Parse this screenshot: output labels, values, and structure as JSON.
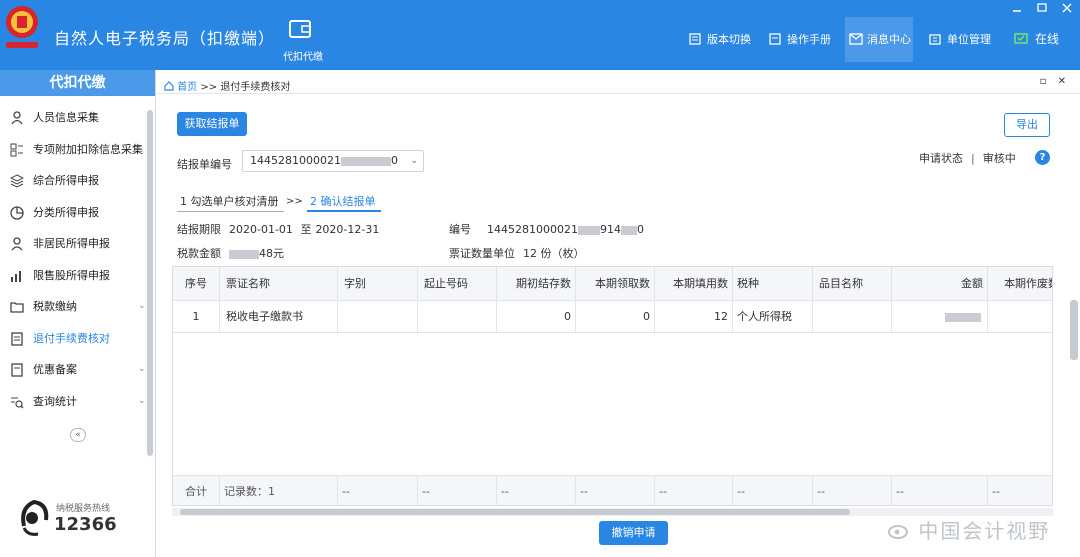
{
  "header": {
    "app_title": "自然人电子税务局（扣缴端）",
    "tile_label": "代扣代缴",
    "nav": [
      {
        "label": "版本切换",
        "icon": "version-icon"
      },
      {
        "label": "操作手册",
        "icon": "manual-icon"
      },
      {
        "label": "消息中心",
        "icon": "mail-icon"
      },
      {
        "label": "单位管理",
        "icon": "building-icon"
      },
      {
        "label": "在线",
        "icon": "online-icon"
      }
    ]
  },
  "sidebar": {
    "title": "代扣代缴",
    "items": [
      {
        "label": "人员信息采集",
        "icon": "person-icon",
        "expandable": false
      },
      {
        "label": "专项附加扣除信息采集",
        "icon": "grid-icon",
        "expandable": false
      },
      {
        "label": "综合所得申报",
        "icon": "layers-icon",
        "expandable": false
      },
      {
        "label": "分类所得申报",
        "icon": "pie-icon",
        "expandable": false
      },
      {
        "label": "非居民所得申报",
        "icon": "user-icon",
        "expandable": false
      },
      {
        "label": "限售股所得申报",
        "icon": "bar-chart-icon",
        "expandable": false
      },
      {
        "label": "税款缴纳",
        "icon": "folder-icon",
        "expandable": true
      },
      {
        "label": "退付手续费核对",
        "icon": "doc-icon",
        "expandable": false,
        "active": true
      },
      {
        "label": "优惠备案",
        "icon": "file-icon",
        "expandable": true
      },
      {
        "label": "查询统计",
        "icon": "search-list-icon",
        "expandable": true
      }
    ],
    "hotline_label": "纳税服务热线",
    "hotline_number": "12366"
  },
  "breadcrumb": {
    "home": "首页",
    "sep": ">>",
    "current": "退付手续费核对"
  },
  "toolbar": {
    "fetch_label": "获取结报单",
    "export_label": "导出",
    "report_no_label": "结报单编号",
    "report_no_value": "1445281000021",
    "report_no_suffix": "0",
    "status_label": "申请状态",
    "status_sep": "|",
    "status_value": "审核中",
    "help": "?"
  },
  "steps": {
    "step1": "1 勾选单户核对清册",
    "arrow": ">>",
    "step2": "2 确认结报单"
  },
  "info": {
    "period_label": "结报期限",
    "period_from": "2020-01-01",
    "period_to_label": "至",
    "period_to": "2020-12-31",
    "no_label": "编号",
    "no_prefix": "1445281000021",
    "no_mid": "914",
    "no_suffix": "0",
    "tax_label": "税款金额",
    "tax_suffix": "48元",
    "unit_label": "票证数量单位",
    "unit_value": "12 份（枚）"
  },
  "table": {
    "headers": [
      "序号",
      "票证名称",
      "字别",
      "起止号码",
      "期初结存数",
      "本期领取数",
      "本期填用数",
      "税种",
      "品目名称",
      "金额",
      "本期作废数"
    ],
    "rows": [
      [
        "1",
        "税收电子缴款书",
        "",
        "",
        "0",
        "0",
        "12",
        "个人所得税",
        "",
        "",
        ""
      ]
    ],
    "footer": [
      "合计",
      "记录数：1",
      "--",
      "--",
      "--",
      "--",
      "--",
      "--",
      "--",
      "--",
      "--"
    ]
  },
  "actions": {
    "cancel_label": "撤销申请"
  },
  "watermark": "中国会计视野"
}
